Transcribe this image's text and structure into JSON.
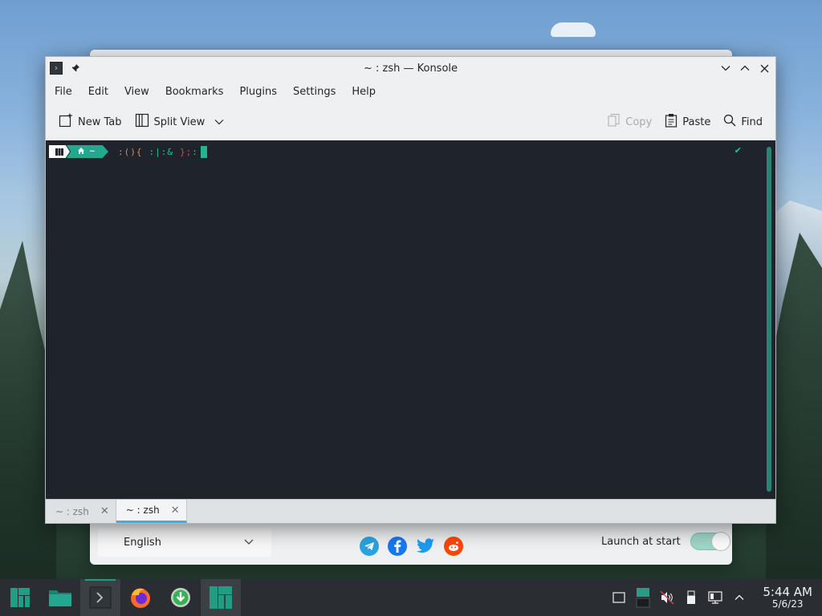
{
  "window": {
    "title": "~ : zsh — Konsole"
  },
  "menu": [
    "File",
    "Edit",
    "View",
    "Bookmarks",
    "Plugins",
    "Settings",
    "Help"
  ],
  "toolbar": {
    "new_tab": "New Tab",
    "split_view": "Split View",
    "copy": "Copy",
    "paste": "Paste",
    "find": "Find"
  },
  "terminal": {
    "prompt_dir": "~",
    "command": {
      "p1": ":(){",
      "p2": ":|:&",
      "p3": "};",
      "p4": ":"
    },
    "status": "✔"
  },
  "tabs": [
    {
      "label": "~ : zsh",
      "active": false
    },
    {
      "label": "~ : zsh",
      "active": true
    }
  ],
  "welcome": {
    "language": "English",
    "launch_label": "Launch at start",
    "launch_enabled": true
  },
  "taskbar": {
    "time": "5:44 AM",
    "date": "5/6/23"
  },
  "colors": {
    "accent": "#1f9e86",
    "terminal_bg": "#1f232b",
    "selection": "#3daee9"
  }
}
